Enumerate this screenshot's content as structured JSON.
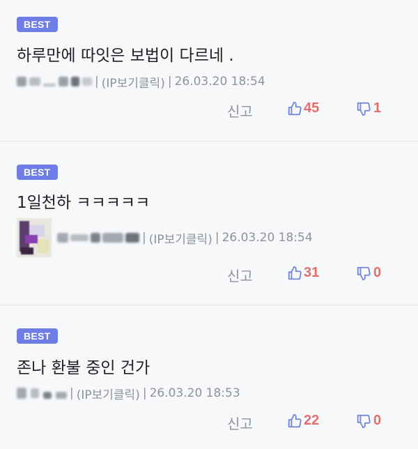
{
  "comments": [
    {
      "badge": "BEST",
      "text": "하루만에 따잇은 보법이 다르네 .",
      "ip_click": "(IP보기클릭)",
      "date": "26.03.20 18:54",
      "report": "신고",
      "likes": "45",
      "dislikes": "1"
    },
    {
      "badge": "BEST",
      "text": "1일천하 ㅋㅋㅋㅋㅋ",
      "ip_click": "(IP보기클릭)",
      "date": "26.03.20 18:54",
      "report": "신고",
      "likes": "31",
      "dislikes": "0"
    },
    {
      "badge": "BEST",
      "text": "존나 환불 중인 건가",
      "ip_click": "(IP보기클릭)",
      "date": "26.03.20 18:53",
      "report": "신고",
      "likes": "22",
      "dislikes": "0"
    }
  ],
  "icons": {
    "like": "thumbs-up-icon",
    "dislike": "thumbs-down-icon"
  },
  "colors": {
    "badge": "#6f7ee6",
    "icon": "#7086dc",
    "count": "#e46e6e",
    "meta": "#8e929a"
  }
}
